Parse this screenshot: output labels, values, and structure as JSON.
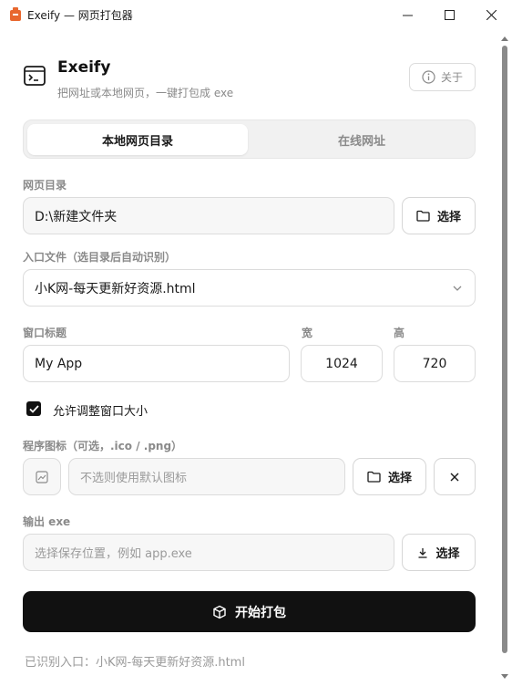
{
  "window": {
    "title": "Exeify — 网页打包器"
  },
  "header": {
    "app_name": "Exeify",
    "subtitle": "把网址或本地网页，一键打包成 exe",
    "about_label": "关于"
  },
  "tabs": [
    {
      "label": "本地网页目录",
      "active": true
    },
    {
      "label": "在线网址",
      "active": false
    }
  ],
  "dir": {
    "label": "网页目录",
    "value": "D:\\新建文件夹",
    "button_label": "选择"
  },
  "entry": {
    "label": "入口文件（选目录后自动识别）",
    "selected": "小K网-每天更新好资源.html"
  },
  "window_opts": {
    "title_label": "窗口标题",
    "title_value": "My App",
    "width_label": "宽",
    "width_value": "1024",
    "height_label": "高",
    "height_value": "720",
    "resizable_label": "允许调整窗口大小",
    "resizable": true
  },
  "icon": {
    "label": "程序图标（可选，.ico / .png）",
    "placeholder": "不选则使用默认图标",
    "button_label": "选择",
    "clear_icon": "close-icon"
  },
  "output": {
    "label": "输出 exe",
    "placeholder": "选择保存位置，例如 app.exe",
    "button_label": "选择"
  },
  "primary": {
    "label": "开始打包"
  },
  "status": {
    "text": "已识别入口：小K网-每天更新好资源.html"
  },
  "colors": {
    "primary": "#111111",
    "muted": "#8a8a8a",
    "border": "#dcdcdc",
    "input_bg": "#f7f7f7"
  }
}
